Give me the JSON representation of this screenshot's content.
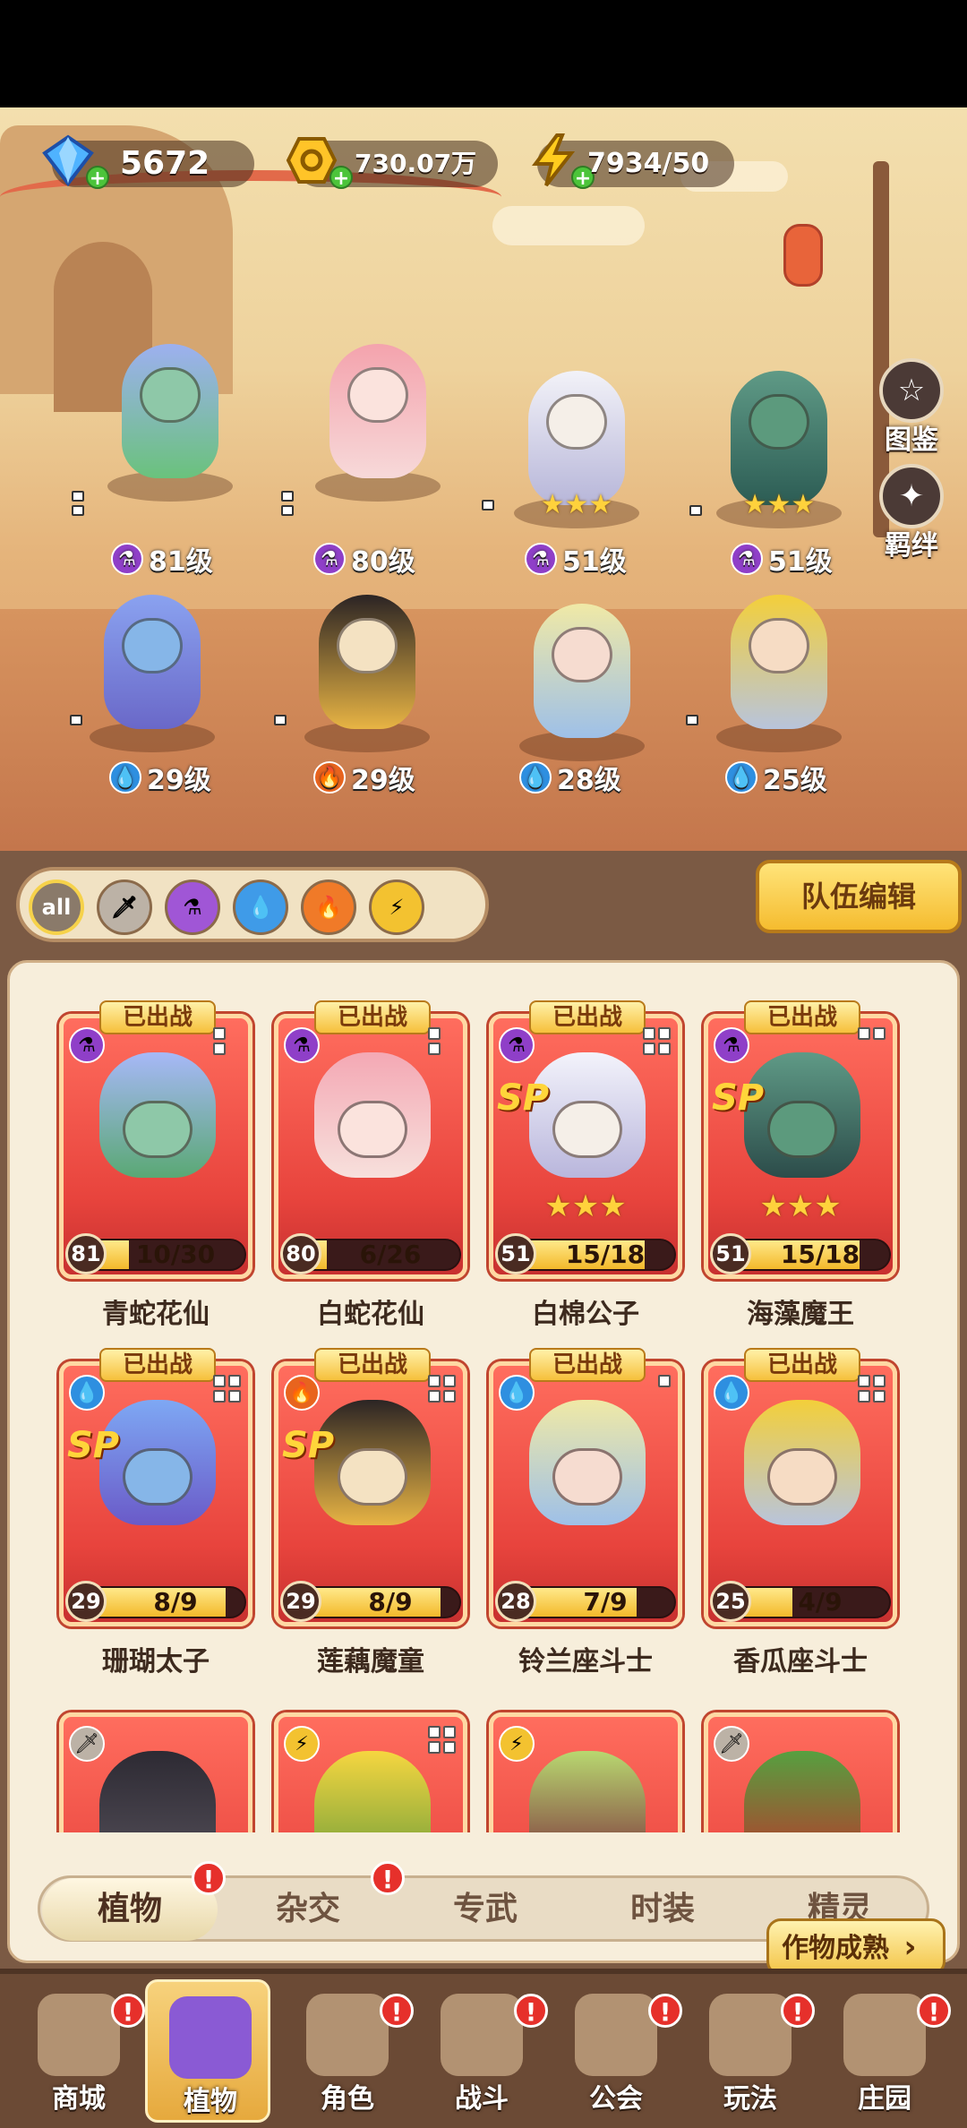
{
  "currencies": {
    "gems": "5672",
    "gold": "730.07万",
    "energy": "7934/50"
  },
  "side_buttons": {
    "atlas": "图鉴",
    "bond": "羁绊"
  },
  "team_heroes": [
    {
      "level": "81级",
      "element": "potion",
      "stars": ""
    },
    {
      "level": "80级",
      "element": "potion",
      "stars": ""
    },
    {
      "level": "51级",
      "element": "potion",
      "stars": "★★★"
    },
    {
      "level": "51级",
      "element": "potion",
      "stars": "★★★"
    },
    {
      "level": "29级",
      "element": "water",
      "stars": ""
    },
    {
      "level": "29级",
      "element": "fire",
      "stars": ""
    },
    {
      "level": "28级",
      "element": "water",
      "stars": ""
    },
    {
      "level": "25级",
      "element": "water",
      "stars": ""
    }
  ],
  "filters": {
    "all_label": "all",
    "options": [
      "all",
      "sword",
      "potion",
      "water",
      "fire",
      "lightning"
    ]
  },
  "team_edit_label": "队伍编辑",
  "cards": [
    {
      "name": "青蛇花仙",
      "level": "81",
      "progress": "10/30",
      "ratio": 0.33,
      "badge": "已出战",
      "element": "potion",
      "sp": "",
      "stars": ""
    },
    {
      "name": "白蛇花仙",
      "level": "80",
      "progress": "6/26",
      "ratio": 0.23,
      "badge": "已出战",
      "element": "potion",
      "sp": "",
      "stars": ""
    },
    {
      "name": "白棉公子",
      "level": "51",
      "progress": "15/18",
      "ratio": 0.83,
      "badge": "已出战",
      "element": "potion",
      "sp": "SP",
      "stars": "★★★"
    },
    {
      "name": "海藻魔王",
      "level": "51",
      "progress": "15/18",
      "ratio": 0.83,
      "badge": "已出战",
      "element": "potion",
      "sp": "SP",
      "stars": "★★★"
    },
    {
      "name": "珊瑚太子",
      "level": "29",
      "progress": "8/9",
      "ratio": 0.89,
      "badge": "已出战",
      "element": "water",
      "sp": "SP",
      "stars": ""
    },
    {
      "name": "莲藕魔童",
      "level": "29",
      "progress": "8/9",
      "ratio": 0.89,
      "badge": "已出战",
      "element": "fire",
      "sp": "SP",
      "stars": ""
    },
    {
      "name": "铃兰座斗士",
      "level": "28",
      "progress": "7/9",
      "ratio": 0.78,
      "badge": "已出战",
      "element": "water",
      "sp": "",
      "stars": ""
    },
    {
      "name": "香瓜座斗士",
      "level": "25",
      "progress": "4/9",
      "ratio": 0.44,
      "badge": "已出战",
      "element": "water",
      "sp": "",
      "stars": ""
    }
  ],
  "partial_cards": [
    {
      "element": "sword"
    },
    {
      "element": "lightning"
    },
    {
      "element": "lightning"
    },
    {
      "element": "sword"
    }
  ],
  "tabs": [
    "植物",
    "杂交",
    "专武",
    "时装",
    "精灵"
  ],
  "tab_alert": "!",
  "crop_mature_label": "作物成熟",
  "nav": [
    "商城",
    "植物",
    "角色",
    "战斗",
    "公会",
    "玩法",
    "庄园"
  ],
  "colors": {
    "card_red": "#e8443d",
    "gold": "#f5bc2f",
    "alert_red": "#e6302b",
    "panel_brown": "#7b5a44"
  }
}
